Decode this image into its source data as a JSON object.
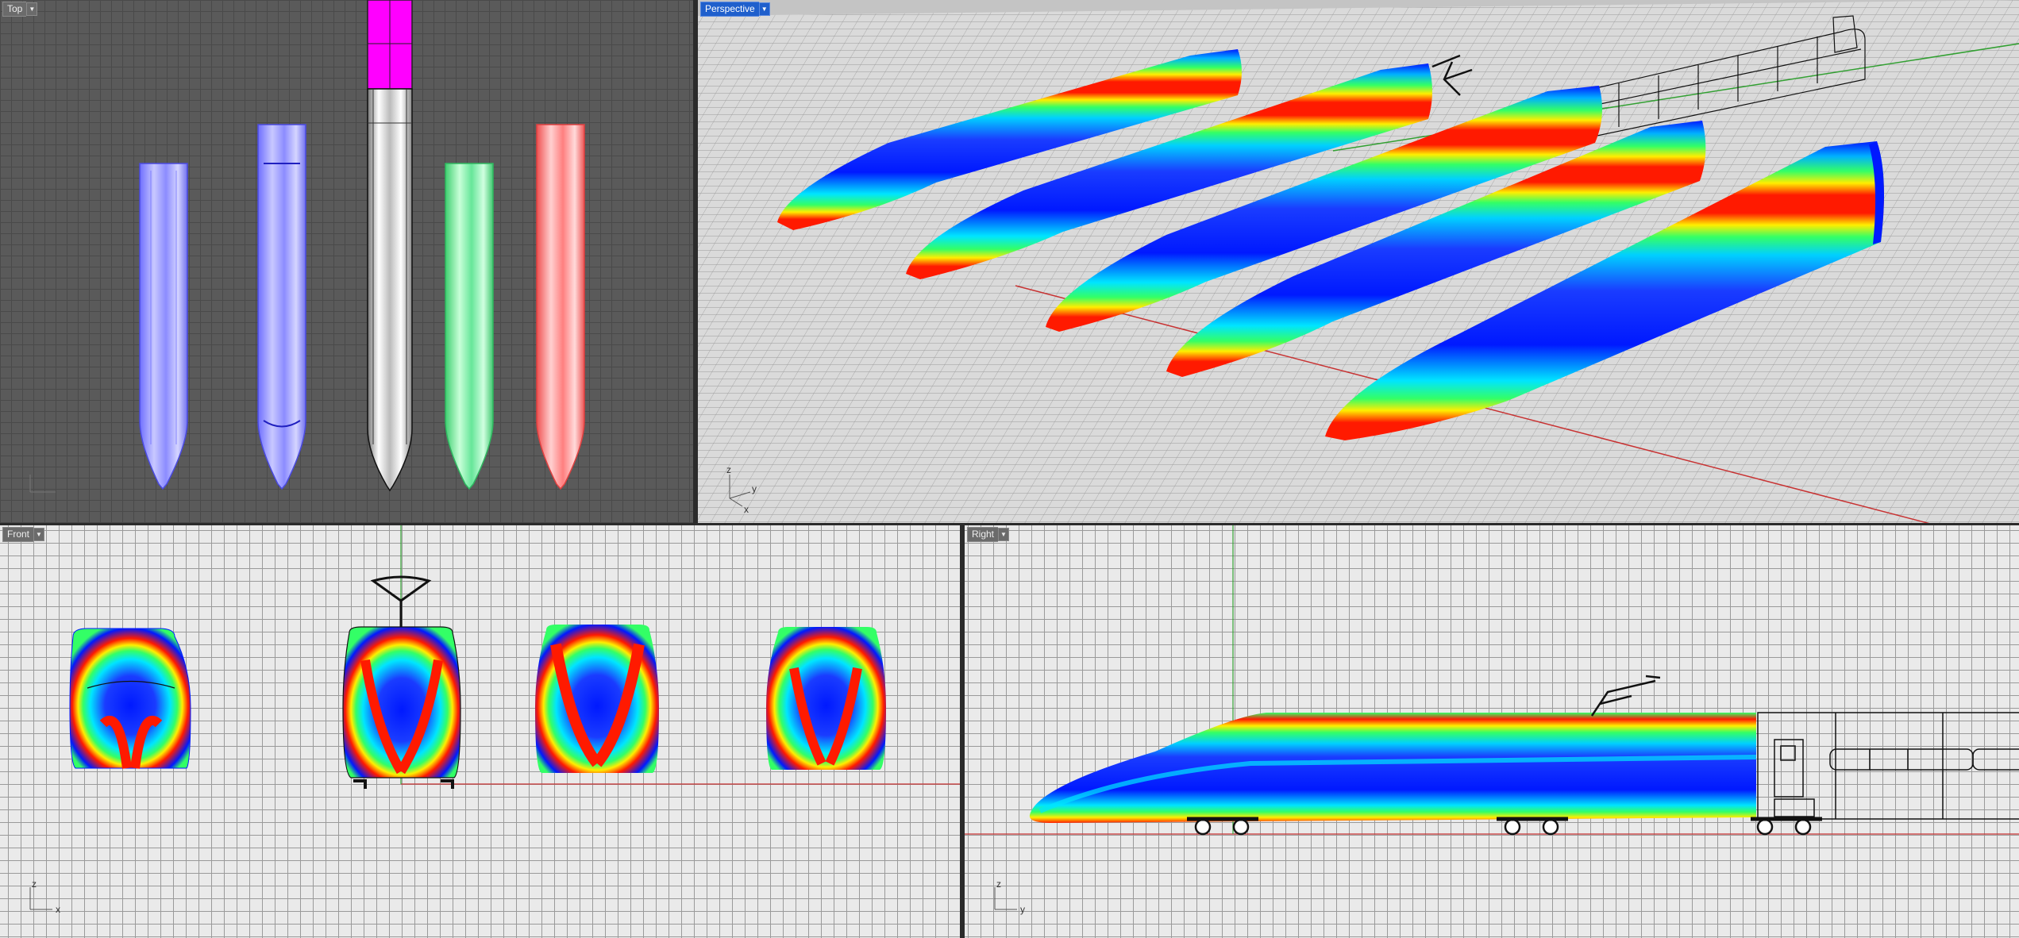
{
  "viewports": {
    "top": {
      "label": "Top",
      "menu_icon": "dropdown-arrow"
    },
    "perspective": {
      "label": "Perspective",
      "menu_icon": "dropdown-arrow",
      "active": true
    },
    "front": {
      "label": "Front",
      "menu_icon": "dropdown-arrow"
    },
    "right": {
      "label": "Right",
      "menu_icon": "dropdown-arrow"
    }
  },
  "axis_indicators": {
    "perspective": {
      "a": "z",
      "b": "y",
      "c": "x"
    },
    "front": {
      "a": "z",
      "b": "x"
    },
    "right": {
      "a": "z",
      "b": "y"
    }
  },
  "colors": {
    "zebra_red": "#ff1a00",
    "zebra_yellow": "#ffee00",
    "zebra_green": "#33ff66",
    "zebra_cyan": "#00e5ff",
    "zebra_blue": "#0019ff",
    "shade_blue": "#8c8cff",
    "shade_green": "#66e699",
    "shade_red": "#ff7f7f",
    "selection_magenta": "#ff00ff",
    "axis_red": "#c83232",
    "axis_green": "#32a032"
  }
}
